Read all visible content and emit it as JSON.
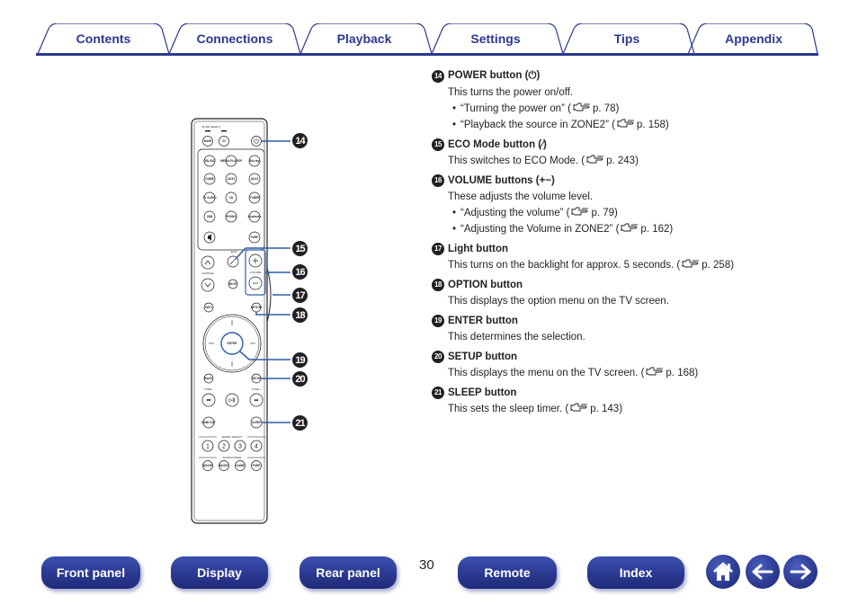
{
  "tabs": [
    {
      "label": "Contents"
    },
    {
      "label": "Connections"
    },
    {
      "label": "Playback"
    },
    {
      "label": "Settings"
    },
    {
      "label": "Tips"
    },
    {
      "label": "Appendix"
    }
  ],
  "remote": {
    "zone_select_label": "ZONE SELECT",
    "buttons": {
      "main": "MAIN",
      "z2": "Z2",
      "cbl_sat": "CBL/SAT",
      "media_player": "MEDIA PLAYER",
      "bluray": "Blu-ray",
      "game": "GAME",
      "aux1": "AUX1",
      "aux2": "AUX2",
      "tv_audio": "TV AUDIO",
      "cd": "CD",
      "tuner": "TUNER",
      "usb": "USB",
      "phono": "PHONO",
      "bluetooth": "Bluetooth",
      "sound_mode_stereo": "PURE",
      "eco": "ECO",
      "ch_page": "CH/PAGE",
      "volume": "VOLUME",
      "info": "INFO",
      "option": "OPTION",
      "enter": "ENTER",
      "back": "BACK",
      "setup": "SETUP",
      "tune_minus": "TUNE -",
      "tune_plus": "TUNE +",
      "hdmi_out": "HDMI OUT",
      "sleep": "SLEEP",
      "smart_select": "SMART SELECT",
      "smart_1": "1",
      "smart_2": "2",
      "smart_3": "3",
      "smart_4": "4",
      "sound_mode": "SOUND MODE",
      "movie": "MOVIE",
      "music": "MUSIC",
      "game_mode": "GAME",
      "pure": "PURE",
      "mute": "MUTE"
    },
    "callouts": [
      "14",
      "15",
      "16",
      "17",
      "18",
      "19",
      "20",
      "21"
    ]
  },
  "descriptions": [
    {
      "num": "14",
      "title": "POWER button (⏻)",
      "text": "This turns the power on/off.",
      "bullets": [
        {
          "text": "“Turning the power on” (",
          "page": "p. 78)"
        },
        {
          "text": "“Playback the source in ZONE2” (",
          "page": "p. 158)"
        }
      ]
    },
    {
      "num": "15",
      "title": "ECO Mode button (∕)",
      "text": "This switches to ECO Mode.  (",
      "page": "p. 243)"
    },
    {
      "num": "16",
      "title": "VOLUME buttons (+−)",
      "text": "These adjusts the volume level.",
      "bullets": [
        {
          "text": "“Adjusting the volume” (",
          "page": "p. 79)"
        },
        {
          "text": "“Adjusting the Volume in ZONE2” (",
          "page": "p. 162)"
        }
      ]
    },
    {
      "num": "17",
      "title": "Light button",
      "text": "This turns on the backlight for approx. 5 seconds.  (",
      "page": "p. 258)"
    },
    {
      "num": "18",
      "title": "OPTION button",
      "text": "This displays the option menu on the TV screen."
    },
    {
      "num": "19",
      "title": "ENTER button",
      "text": "This determines the selection."
    },
    {
      "num": "20",
      "title": "SETUP button",
      "text": "This displays the menu on the TV screen.  (",
      "page": "p. 168)"
    },
    {
      "num": "21",
      "title": "SLEEP button",
      "text": "This sets the sleep timer.  (",
      "page": "p. 143)"
    }
  ],
  "footer": {
    "page_number": "30",
    "buttons": [
      {
        "label": "Front panel"
      },
      {
        "label": "Display"
      },
      {
        "label": "Rear panel"
      },
      {
        "label": "Remote"
      },
      {
        "label": "Index"
      }
    ],
    "icons": [
      "home-icon",
      "back-arrow-icon",
      "forward-arrow-icon"
    ]
  },
  "colors": {
    "brand_blue": "#2b3990",
    "text": "#231f20",
    "callout_line": "#2e5fa8"
  }
}
